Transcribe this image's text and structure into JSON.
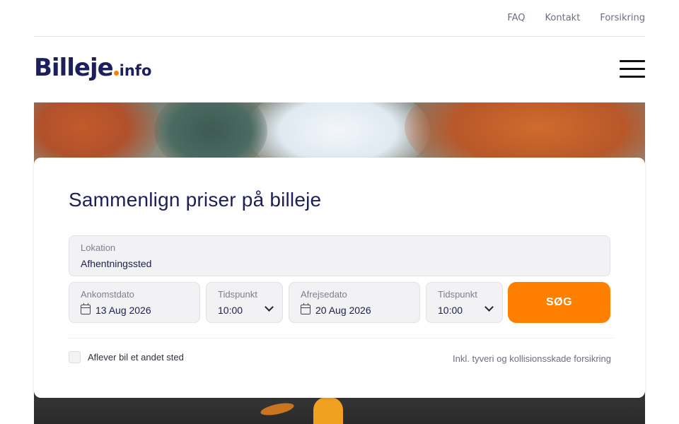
{
  "topbar": {
    "links": [
      "FAQ",
      "Kontakt",
      "Forsikring"
    ]
  },
  "header": {
    "logo_main": "Billeje",
    "logo_suffix": "info",
    "logo_accent": "#ff7f00",
    "menu_icon": "hamburger-menu-icon"
  },
  "search_card": {
    "title": "Sammenlign priser på billeje",
    "location": {
      "label": "Lokation",
      "value": "Afhentningssted"
    },
    "pickup_date": {
      "label": "Ankomstdato",
      "value": "13 Aug 2026",
      "icon": "calendar-icon"
    },
    "pickup_time": {
      "label": "Tidspunkt",
      "value": "10:00",
      "icon": "chevron-down-icon"
    },
    "return_date": {
      "label": "Afrejsedato",
      "value": "20 Aug 2026",
      "icon": "calendar-icon"
    },
    "return_time": {
      "label": "Tidspunkt",
      "value": "10:00",
      "icon": "chevron-down-icon"
    },
    "search_label": "SØG",
    "search_color": "#ff7f00",
    "different_dropoff_label": "Aflever bil et andet sted",
    "insurance_note": "Inkl. tyveri og kollisionsskade forsikring"
  }
}
